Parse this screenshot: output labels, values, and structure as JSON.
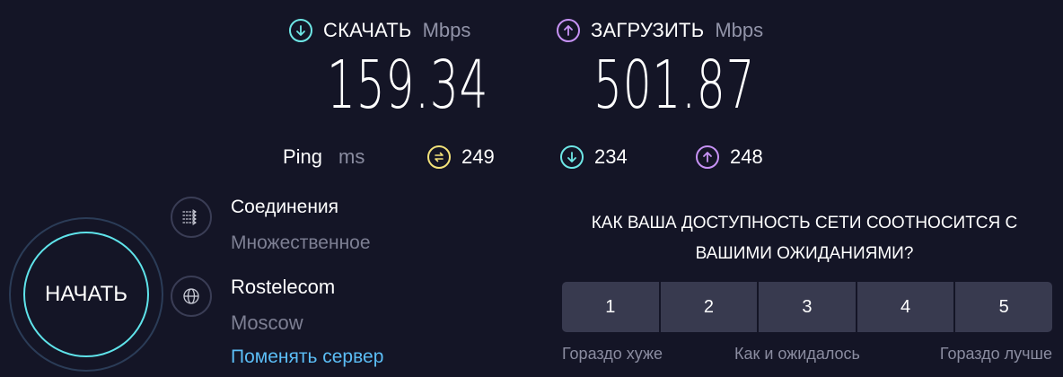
{
  "download": {
    "label": "СКАЧАТЬ",
    "unit": "Mbps",
    "value": "159.34",
    "icon": "download-arrow-icon"
  },
  "upload": {
    "label": "ЗАГРУЗИТЬ",
    "unit": "Mbps",
    "value": "501.87",
    "icon": "upload-arrow-icon"
  },
  "ping": {
    "label": "Ping",
    "unit": "ms",
    "idle": "249",
    "download": "234",
    "upload": "248"
  },
  "start_button": {
    "label": "НАЧАТЬ"
  },
  "connections": {
    "title": "Соединения",
    "value": "Множественное"
  },
  "server": {
    "provider": "Rostelecom",
    "city": "Moscow",
    "change_link": "Поменять сервер"
  },
  "survey": {
    "question": "КАК ВАША ДОСТУПНОСТЬ СЕТИ СООТНОСИТСЯ С ВАШИМИ ОЖИДАНИЯМИ?",
    "options": [
      "1",
      "2",
      "3",
      "4",
      "5"
    ],
    "scale_low": "Гораздо хуже",
    "scale_mid": "Как и ожидалось",
    "scale_high": "Гораздо лучше"
  },
  "colors": {
    "background": "#141526",
    "download_accent": "#6ee7e6",
    "upload_accent": "#c792f5",
    "ping_accent": "#f3e27a",
    "link": "#5bbdf5",
    "rating_button": "#383a4f"
  }
}
